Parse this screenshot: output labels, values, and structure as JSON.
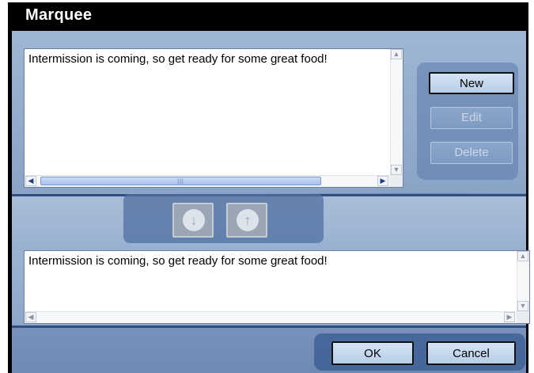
{
  "window": {
    "title": "Marquee"
  },
  "messages_list": {
    "items": [
      "Intermission is coming, so get ready for some great food!"
    ]
  },
  "side_buttons": {
    "new": "New",
    "edit": "Edit",
    "delete": "Delete"
  },
  "reorder": {
    "down_icon": "arrow-down-icon",
    "up_icon": "arrow-up-icon"
  },
  "message_text": {
    "value": "Intermission is coming, so get ready for some great food!"
  },
  "dialog_buttons": {
    "ok": "OK",
    "cancel": "Cancel"
  }
}
